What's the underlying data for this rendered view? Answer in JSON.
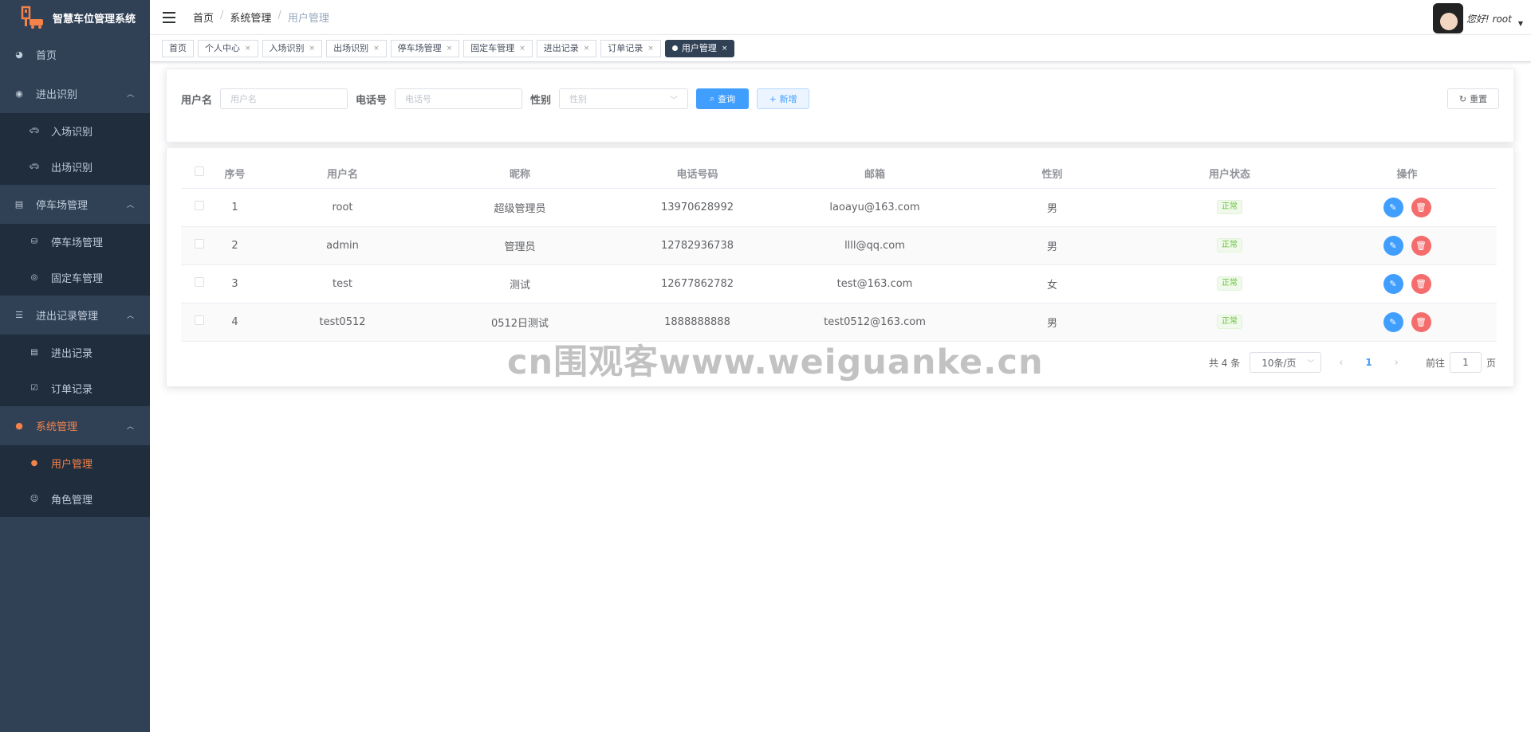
{
  "app": {
    "title": "智慧车位管理系统"
  },
  "sidebar": {
    "items": [
      {
        "label": "首页",
        "icon": "dashboard-icon"
      },
      {
        "label": "进出识别",
        "icon": "recognition-icon",
        "children": [
          {
            "label": "入场识别",
            "icon": "car-icon"
          },
          {
            "label": "出场识别",
            "icon": "car-icon"
          }
        ]
      },
      {
        "label": "停车场管理",
        "icon": "document-icon",
        "children": [
          {
            "label": "停车场管理",
            "icon": "parking-icon"
          },
          {
            "label": "固定车管理",
            "icon": "fixed-car-icon"
          }
        ]
      },
      {
        "label": "进出记录管理",
        "icon": "record-icon",
        "children": [
          {
            "label": "进出记录",
            "icon": "list-icon"
          },
          {
            "label": "订单记录",
            "icon": "order-icon"
          }
        ]
      },
      {
        "label": "系统管理",
        "icon": "user-icon",
        "children": [
          {
            "label": "用户管理",
            "icon": "user-icon"
          },
          {
            "label": "角色管理",
            "icon": "role-icon"
          }
        ]
      }
    ]
  },
  "navbar": {
    "breadcrumb": [
      "首页",
      "系统管理",
      "用户管理"
    ],
    "greeting": "您好! root"
  },
  "tags": [
    "首页",
    "个人中心",
    "入场识别",
    "出场识别",
    "停车场管理",
    "固定车管理",
    "进出记录",
    "订单记录",
    "用户管理"
  ],
  "search": {
    "username_label": "用户名",
    "username_placeholder": "用户名",
    "phone_label": "电话号",
    "phone_placeholder": "电话号",
    "gender_label": "性别",
    "gender_placeholder": "性别",
    "query_label": "查询",
    "add_label": "新增",
    "reset_label": "重置"
  },
  "table": {
    "columns": [
      "序号",
      "用户名",
      "昵称",
      "电话号码",
      "邮箱",
      "性别",
      "用户状态",
      "操作"
    ],
    "rows": [
      {
        "index": "1",
        "username": "root",
        "nickname": "超级管理员",
        "phone": "13970628992",
        "email": "laoayu@163.com",
        "gender": "男",
        "status": "正常"
      },
      {
        "index": "2",
        "username": "admin",
        "nickname": "管理员",
        "phone": "12782936738",
        "email": "llll@qq.com",
        "gender": "男",
        "status": "正常"
      },
      {
        "index": "3",
        "username": "test",
        "nickname": "测试",
        "phone": "12677862782",
        "email": "test@163.com",
        "gender": "女",
        "status": "正常"
      },
      {
        "index": "4",
        "username": "test0512",
        "nickname": "0512日测试",
        "phone": "1888888888",
        "email": "test0512@163.com",
        "gender": "男",
        "status": "正常"
      }
    ]
  },
  "pagination": {
    "total": "共 4 条",
    "page_size": "10条/页",
    "current_page": "1",
    "goto_label": "前往",
    "goto_value": "1",
    "page_suffix": "页"
  },
  "watermark": "cn围观客www.weiguanke.cn",
  "colors": {
    "sidebar_bg": "#304156",
    "accent": "#f4824a",
    "primary": "#409eff",
    "danger": "#f56c6c",
    "success": "#67c23a"
  }
}
